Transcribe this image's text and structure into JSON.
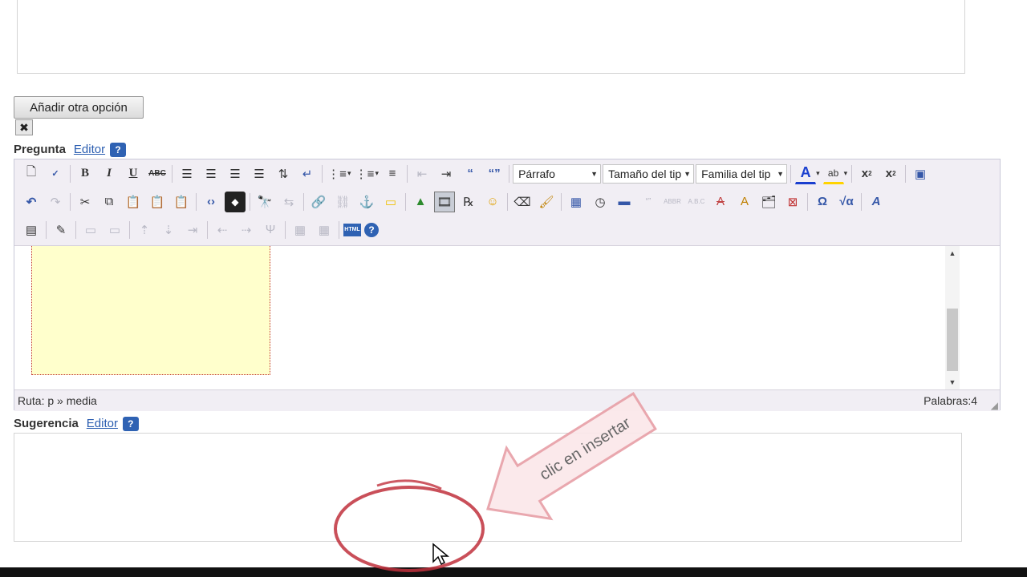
{
  "add_option_button": "Añadir otra opción",
  "remove_icon_glyph": "✖",
  "pregunta": {
    "label": "Pregunta",
    "editor_link": "Editor",
    "help": "?"
  },
  "toolbar": {
    "paragraph_select": "Párrafo",
    "font_size_select": "Tamaño del tip",
    "font_family_select": "Familia del tip",
    "text_color": "#1a3fcf",
    "highlight_color": "#ffd300"
  },
  "statusbar": {
    "path": "Ruta: p » media",
    "words": "Palabras:4"
  },
  "sugerencia": {
    "label": "Sugerencia",
    "editor_link": "Editor",
    "help": "?"
  },
  "annotation": {
    "text": "clic en insertar",
    "arrow_color": "#e8a0a8",
    "circle_color": "#c0303c"
  }
}
